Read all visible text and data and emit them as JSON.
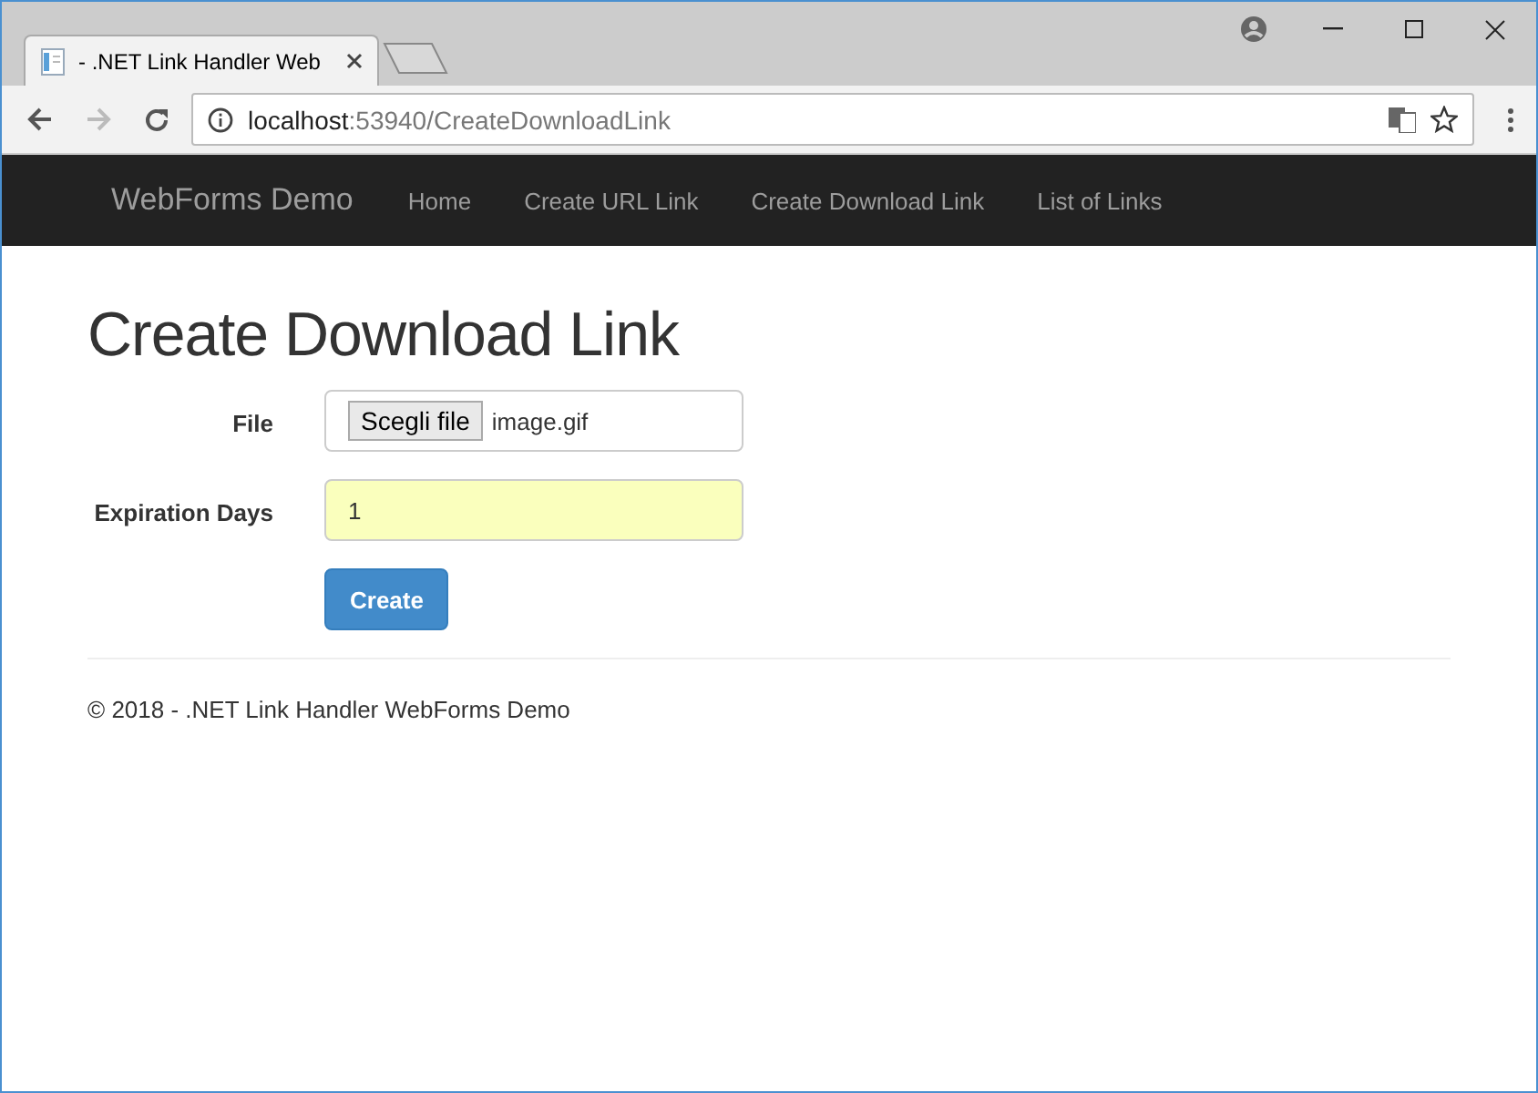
{
  "browser": {
    "tab_title": "- .NET Link Handler Web",
    "address": {
      "host": "localhost",
      "path": ":53940/CreateDownloadLink"
    }
  },
  "navbar": {
    "brand": "WebForms Demo",
    "links": [
      "Home",
      "Create URL Link",
      "Create Download Link",
      "List of Links"
    ]
  },
  "page": {
    "heading": "Create Download Link",
    "fields": [
      {
        "kind": "file",
        "label": "File",
        "button": "Scegli file",
        "value": "image.gif"
      },
      {
        "kind": "text",
        "label": "Expiration Days",
        "value": "1",
        "autofilled": true
      }
    ],
    "submit": "Create"
  },
  "footer": "© 2018 - .NET Link Handler WebForms Demo"
}
